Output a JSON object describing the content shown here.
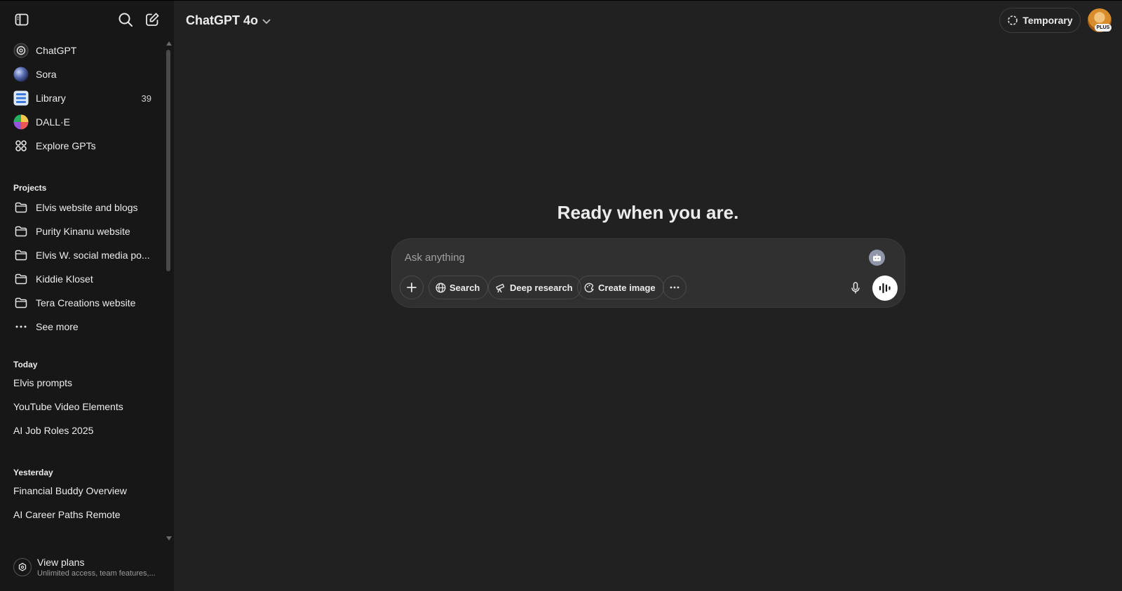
{
  "sidebar": {
    "top_icons": [
      "toggle-sidebar-icon",
      "search-icon",
      "new-chat-icon"
    ],
    "nav_items": [
      {
        "label": "ChatGPT",
        "icon": "chatgpt-logo-icon"
      },
      {
        "label": "Sora",
        "icon": "sora-icon"
      },
      {
        "label": "Library",
        "icon": "library-icon",
        "count": "39"
      },
      {
        "label": "DALL·E",
        "icon": "dalle-icon"
      },
      {
        "label": "Explore GPTs",
        "icon": "grid-icon"
      }
    ],
    "projects_title": "Projects",
    "projects": [
      {
        "label": "Elvis website and blogs"
      },
      {
        "label": "Purity Kinanu website"
      },
      {
        "label": "Elvis W. social media po..."
      },
      {
        "label": "Kiddie Kloset"
      },
      {
        "label": "Tera Creations website"
      }
    ],
    "see_more": "See more",
    "today_title": "Today",
    "today": [
      "Elvis prompts",
      "YouTube Video Elements",
      "AI Job Roles 2025"
    ],
    "yesterday_title": "Yesterday",
    "yesterday": [
      "Financial Buddy Overview",
      "AI Career Paths Remote"
    ],
    "plans": {
      "title": "View plans",
      "subtitle": "Unlimited access, team features,..."
    }
  },
  "header": {
    "model": "ChatGPT 4o",
    "temporary_label": "Temporary",
    "avatar_badge": "PLUS"
  },
  "main": {
    "headline": "Ready when you are.",
    "composer": {
      "placeholder": "Ask anything",
      "tools": [
        "Search",
        "Deep research",
        "Create image"
      ]
    }
  },
  "colors": {
    "sidebar_bg": "#171717",
    "main_bg": "#212121",
    "composer_bg": "#303030",
    "text": "#ececec"
  }
}
